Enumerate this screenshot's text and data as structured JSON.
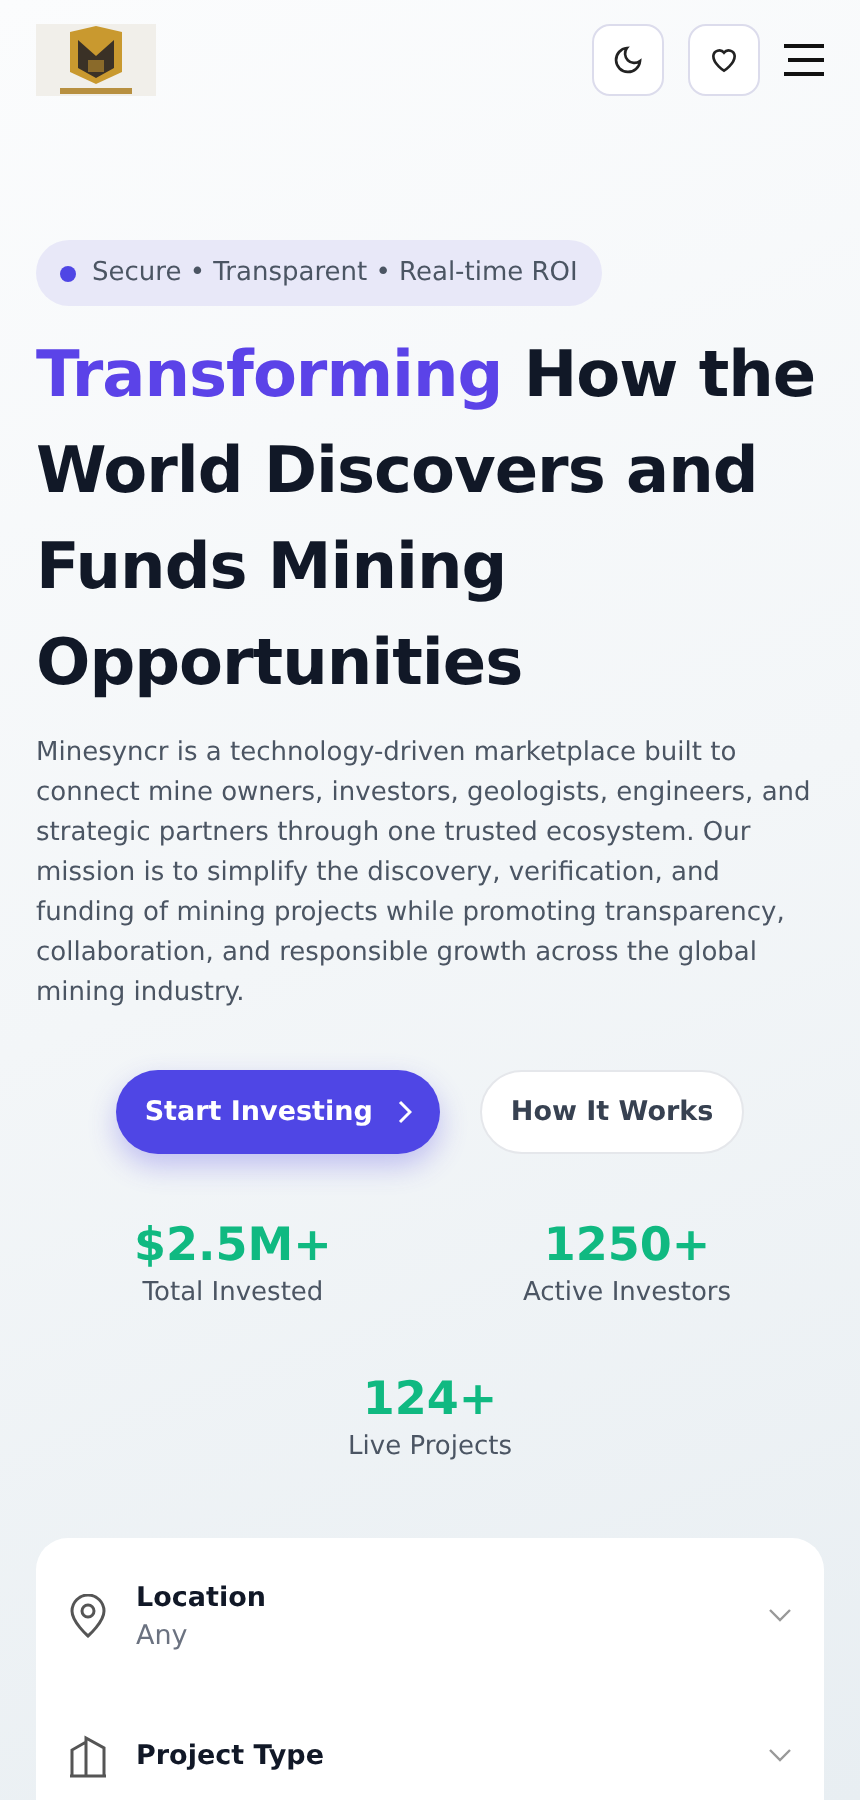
{
  "header": {
    "buttons": [
      {
        "kind": "theme"
      },
      {
        "kind": "favorites"
      },
      {
        "kind": "menu"
      }
    ]
  },
  "badge": {
    "text": "Secure • Transparent • Real-time ROI",
    "color": "#4f46e5"
  },
  "heading": {
    "highlight": "Transforming",
    "rest": "How the World Discovers and Funds Mining Opportunities"
  },
  "description": "Minesyncr is a technology-driven marketplace built to connect mine owners, investors, geologists, engineers, and strategic partners through one trusted ecosystem. Our mission is to simplify the discovery, verification, and funding of mining projects while promoting transparency, collaboration, and responsible growth across the global mining industry.",
  "actions": [
    {
      "label": "Start Investing",
      "kind": "primary"
    },
    {
      "label": "How It Works",
      "kind": "secondary"
    }
  ],
  "stats": [
    {
      "value": "$2.5M+",
      "label": "Total Invested"
    },
    {
      "value": "1250+",
      "label": "Active Investors"
    },
    {
      "value": "124+",
      "label": "Live Projects"
    }
  ],
  "filters": [
    {
      "kind": "location",
      "label": "Location",
      "value": "Any"
    },
    {
      "kind": "building",
      "label": "Project Type"
    }
  ]
}
